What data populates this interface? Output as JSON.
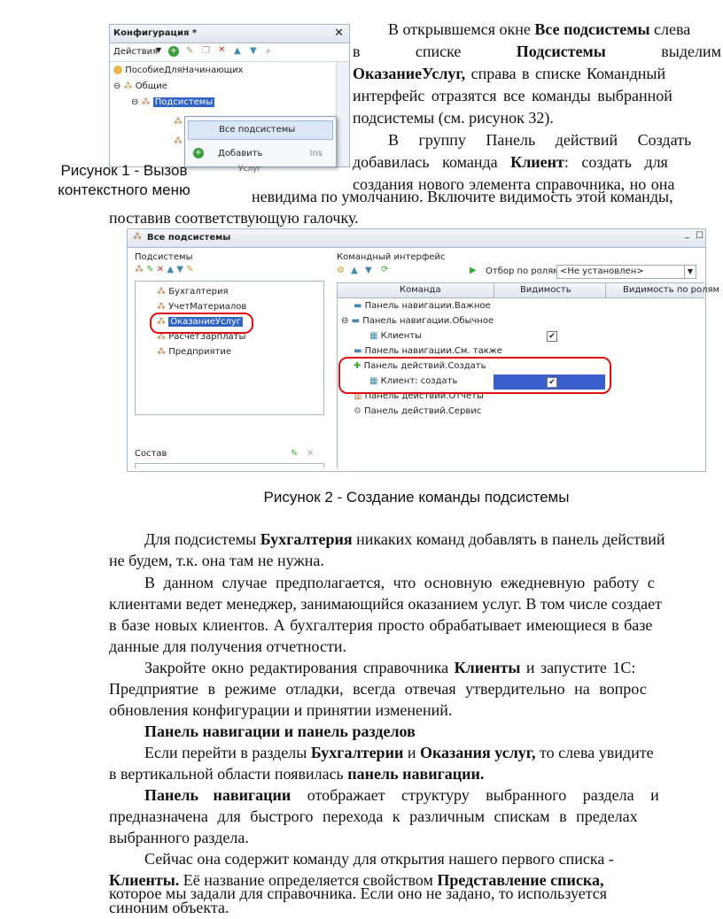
{
  "fig1": {
    "window_title": "Конфигурация *",
    "actions_label": "Действия",
    "tree": [
      "ПособиеДляНачинающих",
      "Общие",
      "Подсистемы"
    ],
    "menu": {
      "item1": "Все подсистемы",
      "item2": "Добавить",
      "item2_shortcut": "Ins"
    },
    "caption_line1": "Рисунок 1 - Вызов",
    "caption_line2": "контекстного меню",
    "cut_text": "Услуг"
  },
  "right_text": {
    "l1a": "В открывшемся окне ",
    "l1b": "Все подсистемы",
    "l1c": " слева",
    "l2a": "в",
    "l2b": "списке",
    "l2c": "Подсистемы",
    "l2d": "выделим",
    "l3a": "ОказаниеУслуг,",
    "l3b": " справа в списке Командный",
    "l4": "интерфейс отразятся все команды выбранной",
    "l5": "подсистемы (см. рисунок 32).",
    "l6": "В группу Панель действий Создать",
    "l7a": "добавилась команда ",
    "l7b": "Клиент",
    "l7c": ": создать для",
    "l8": "создания нового элемента справочника, но она",
    "l9": "невидима по умолчанию. Включите видимость этой команды,",
    "l10": "поставив соответствующую галочку."
  },
  "fig2": {
    "window_title": "Все подсистемы",
    "left_header": "Подсистемы",
    "subsystems": [
      "Бухгалтерия",
      "УчетМатериалов",
      "ОказаниеУслуг",
      "РасчетЗарплаты",
      "Предприятие"
    ],
    "sostav": "Состав",
    "right_header": "Командный интерфейс",
    "filter_label": "Отбор по ролям:",
    "filter_value": "<Не установлен>",
    "columns": [
      "Команда",
      "Видимость",
      "Видимость по ролям"
    ],
    "rows": [
      "Панель навигации.Важное",
      "Панель навигации.Обычное",
      "Клиенты",
      "Панель навигации.См. также",
      "Панель действий.Создать",
      "Клиент: создать",
      "Панель действий.Отчеты",
      "Панель действий.Сервис"
    ],
    "check_mark": "✔",
    "caption": "Рисунок 2 - Создание команды подсистемы"
  },
  "body": {
    "p1a": "Для подсистемы ",
    "p1b": "Бухгалтерия",
    "p1c": " никаких команд добавлять в панель действий",
    "p1d": "не будем, т.к. она там не нужна.",
    "p2l1": "В данном случае предполагается, что основную ежедневную работу с",
    "p2l2": "клиентами ведет менеджер, занимающийся оказанием услуг. В том числе создает",
    "p2l3": "в базе новых клиентов. А бухгалтерия просто обрабатывает имеющиеся в базе",
    "p2l4": "данные для получения отчетности.",
    "p3l1a": "Закройте окно редактирования справочника ",
    "p3l1b": "Клиенты",
    "p3l1c": " и запустите 1С:",
    "p3l2": "Предприятие в режиме отладки, всегда отвечая утвердительно на вопрос",
    "p3l3": "обновления конфигурации и принятии изменений.",
    "heading": "Панель навигации и панель разделов",
    "p4l1a": "Если перейти в разделы ",
    "p4l1b": "Бухгалтерии",
    "p4l1c": " и ",
    "p4l1d": "Оказания услуг,",
    "p4l1e": " то слева увидите",
    "p4l2a": "в вертикальной области появилась ",
    "p4l2b": "панель навигации.",
    "p5l1a": "Панель навигации",
    "p5l1b": " отображает структуру выбранного раздела и",
    "p5l2": "предназначена для быстрого перехода к различным спискам в пределах",
    "p5l3": "выбранного раздела.",
    "p6l1": "Сейчас она содержит команду для открытия нашего первого списка -",
    "p6l2a": "Клиенты.",
    "p6l2b": " Её название определяется свойством ",
    "p6l2c": "Представление списка,",
    "p6l3": "которое мы задали для справочника. Если оно не задано, то используется",
    "p6l4": "синоним объекта."
  }
}
